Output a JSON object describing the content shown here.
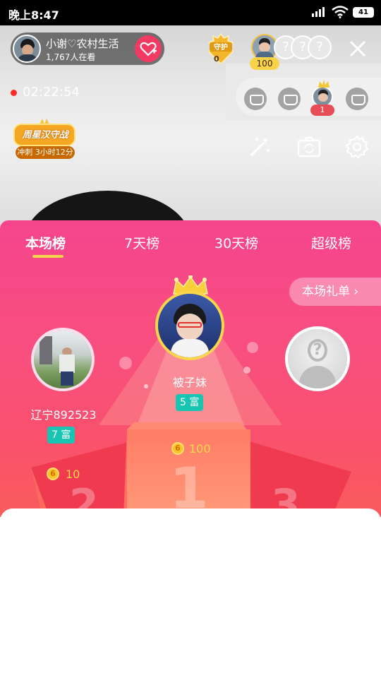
{
  "status": {
    "time": "晚上8:47",
    "battery": "41"
  },
  "host": {
    "name": "小谢♡农村生活",
    "viewers": "1,767人在看"
  },
  "guard": {
    "label": "守护",
    "count": "0"
  },
  "top_viewer": {
    "score": "100"
  },
  "live": {
    "timer": "02:22:54"
  },
  "seats": {
    "count": "1"
  },
  "weekly": {
    "title": "周星汉守战",
    "sub": "冲刺 3小时12分"
  },
  "tabs": [
    "本场榜",
    "7天榜",
    "30天榜",
    "超级榜"
  ],
  "gift_list": {
    "label": "本场礼单 ›"
  },
  "ranking": {
    "first": {
      "name": "被子妹",
      "rich": "5 富",
      "coins": "100",
      "rank": "1"
    },
    "second": {
      "name": "辽宁892523",
      "rich": "7 富",
      "coins": "10",
      "rank": "2"
    },
    "third": {
      "rank": "3"
    }
  },
  "colors": {
    "accent": "#f6458d",
    "rich_badge": "#18c5b2",
    "gold": "#f8d34a"
  }
}
